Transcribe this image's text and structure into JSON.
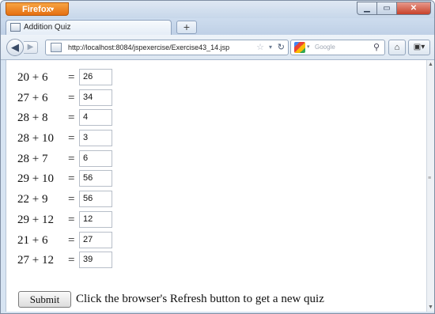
{
  "browser": {
    "app_button": "Firefox",
    "tab_title": "Addition Quiz",
    "new_tab": "+",
    "url": "http://localhost:8084/jspexercise/Exercise43_14.jsp",
    "search_placeholder": "Google"
  },
  "quiz": {
    "rows": [
      {
        "question": "20 + 6",
        "equals": "=",
        "answer": "26"
      },
      {
        "question": "27 + 6",
        "equals": "=",
        "answer": "34"
      },
      {
        "question": "28 + 8",
        "equals": "=",
        "answer": "4"
      },
      {
        "question": "28 + 10",
        "equals": "=",
        "answer": "3"
      },
      {
        "question": "28 + 7",
        "equals": "=",
        "answer": "6"
      },
      {
        "question": "29 + 10",
        "equals": "=",
        "answer": "56"
      },
      {
        "question": "22 + 9",
        "equals": "=",
        "answer": "56"
      },
      {
        "question": "29 + 12",
        "equals": "=",
        "answer": "12"
      },
      {
        "question": "21 + 6",
        "equals": "=",
        "answer": "27"
      },
      {
        "question": "27 + 12",
        "equals": "=",
        "answer": "39"
      }
    ],
    "submit_label": "Submit",
    "instructions": "Click the browser's Refresh button to get a new quiz"
  }
}
